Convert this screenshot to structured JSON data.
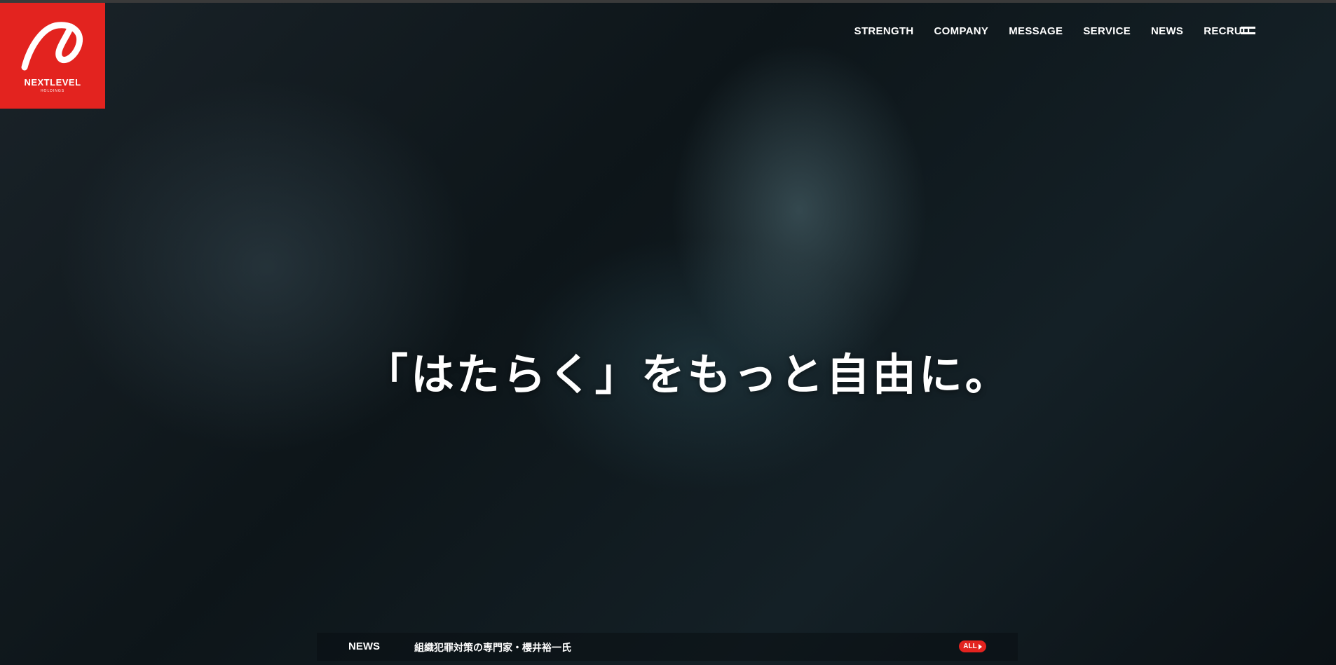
{
  "brand": {
    "name": "NEXTLEVEL",
    "sub": "HOLDINGS",
    "color": "#e3231f"
  },
  "nav": {
    "items": [
      {
        "label": "STRENGTH"
      },
      {
        "label": "COMPANY"
      },
      {
        "label": "MESSAGE"
      },
      {
        "label": "SERVICE"
      },
      {
        "label": "NEWS"
      },
      {
        "label": "RECRUIT"
      }
    ],
    "menu_icon": "hamburger-icon"
  },
  "hero": {
    "headline": "「はたらく」をもっと自由に。"
  },
  "news": {
    "label": "NEWS",
    "title": "組織犯罪対策の専門家・櫻井裕一氏",
    "all_label": "ALL"
  }
}
